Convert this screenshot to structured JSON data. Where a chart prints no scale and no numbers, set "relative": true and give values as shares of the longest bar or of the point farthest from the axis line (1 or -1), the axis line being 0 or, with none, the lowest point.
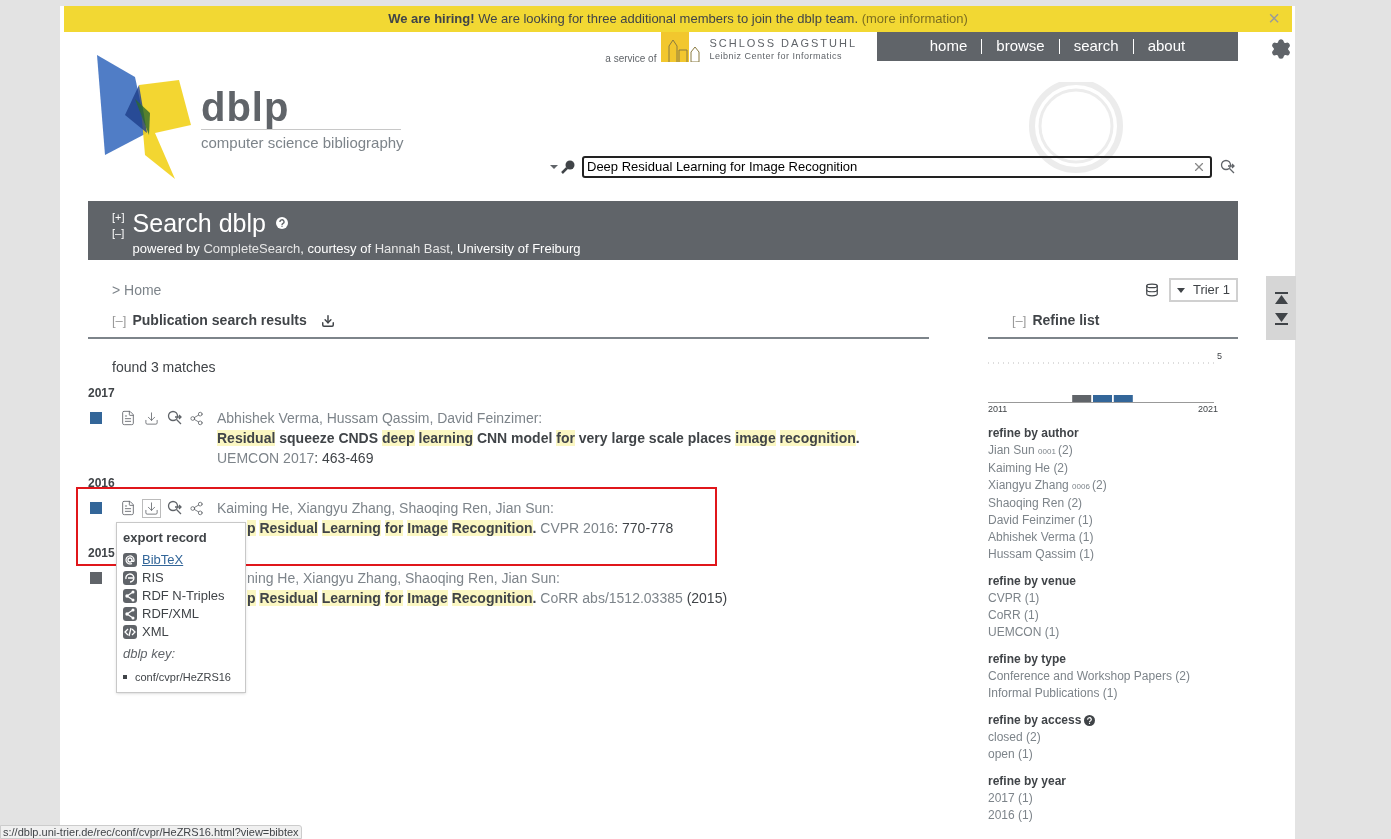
{
  "banner": {
    "text": "**We are hiring!** We are looking for three additional members to join the dblp team.",
    "link": "(more information)",
    "close": "×"
  },
  "header": {
    "logo_title": "dblp",
    "logo_subtitle": "computer science bibliography",
    "service_of": "a service of",
    "dagstuhl_name": "SCHLOSS DAGSTUHL",
    "dagstuhl_sub": "Leibniz Center for Informatics",
    "nav": [
      "home",
      "browse",
      "search",
      "about"
    ],
    "search": {
      "value": "Deep Residual Learning for Image Recognition"
    }
  },
  "search_panel": {
    "expand": "[+]",
    "collapse": "[–]",
    "title": "Search dblp",
    "powered_prefix": "powered by",
    "engine": "CompleteSearch",
    "courtesy": ", courtesy of",
    "person": "Hannah Bast",
    "university": ", University of Freiburg"
  },
  "breadcrumb": "> Home",
  "mirror": "Trier 1",
  "results": {
    "toggle": "[–]",
    "title": "Publication search results",
    "found": "found 3 matches",
    "groups": [
      {
        "year": "2017",
        "entries": [
          {
            "color": "#336699",
            "icons_covered": false,
            "export_open": false,
            "annotated": false,
            "authors_covered": false,
            "title_covered": false,
            "authors": "Abhishek Verma, Hussam Qassim, David Feinzimer:",
            "title": [
              {
                "text": "Residual",
                "hit": true,
                "joined": false
              },
              {
                "text": "squeeze CNDS",
                "hit": false,
                "joined": false
              },
              {
                "text": "deep",
                "hit": true,
                "joined": false
              },
              {
                "text": "learning",
                "hit": true,
                "joined": false
              },
              {
                "text": "CNN model",
                "hit": false,
                "joined": false
              },
              {
                "text": "for",
                "hit": true,
                "joined": false
              },
              {
                "text": "very large scale places",
                "hit": false,
                "joined": false
              },
              {
                "text": "image",
                "hit": true,
                "joined": false
              },
              {
                "text": "recognition",
                "hit": true,
                "joined": false
              },
              {
                "text": ".",
                "hit": false,
                "joined": true
              }
            ],
            "venue": "UEMCON 2017",
            "pages": ": 463-469"
          }
        ]
      },
      {
        "year": "2016",
        "entries": [
          {
            "color": "#336699",
            "icons_covered": false,
            "export_open": true,
            "annotated": true,
            "authors_covered": false,
            "title_covered": true,
            "authors": "Kaiming He, Xiangyu Zhang, Shaoqing Ren, Jian Sun:",
            "title": [
              {
                "text": "p",
                "hit": true,
                "joined": false
              },
              {
                "text": "Residual",
                "hit": true,
                "joined": false
              },
              {
                "text": "Learning",
                "hit": true,
                "joined": false
              },
              {
                "text": "for",
                "hit": true,
                "joined": false
              },
              {
                "text": "Image",
                "hit": true,
                "joined": false
              },
              {
                "text": "Recognition",
                "hit": true,
                "joined": false
              },
              {
                "text": ".",
                "hit": false,
                "joined": true
              }
            ],
            "venue": "CVPR 2016",
            "pages": ": 770-778"
          }
        ]
      },
      {
        "year": "2015",
        "entries": [
          {
            "color": "#606469",
            "icons_covered": true,
            "export_open": false,
            "annotated": false,
            "authors_covered": true,
            "title_covered": true,
            "authors": "ning He, Xiangyu Zhang, Shaoqing Ren, Jian Sun:",
            "title": [
              {
                "text": "p",
                "hit": true,
                "joined": false
              },
              {
                "text": "Residual",
                "hit": true,
                "joined": false
              },
              {
                "text": "Learning",
                "hit": true,
                "joined": false
              },
              {
                "text": "for",
                "hit": true,
                "joined": false
              },
              {
                "text": "Image",
                "hit": true,
                "joined": false
              },
              {
                "text": "Recognition",
                "hit": true,
                "joined": false
              },
              {
                "text": ".",
                "hit": false,
                "joined": true
              }
            ],
            "venue": "CoRR abs/1512.03385",
            "pages": " (2015)"
          }
        ]
      }
    ]
  },
  "export_popup": {
    "title": "export record",
    "items": [
      {
        "kind": "bibtex",
        "label": "BibTeX",
        "selected": true
      },
      {
        "kind": "ris",
        "label": "RIS",
        "selected": false
      },
      {
        "kind": "rdf",
        "label": "RDF N-Triples",
        "selected": false
      },
      {
        "kind": "rdf",
        "label": "RDF/XML",
        "selected": false
      },
      {
        "kind": "xml",
        "label": "XML",
        "selected": false
      }
    ],
    "key_label": "dblp key:",
    "key": "conf/cvpr/HeZRS16"
  },
  "refine": {
    "toggle": "[–]",
    "title": "Refine list",
    "chart_data": {
      "type": "bar",
      "categories": [
        "2011",
        null,
        null,
        null,
        null,
        null,
        null,
        null,
        null,
        null,
        "2021"
      ],
      "relative": true,
      "annotations": [
        {
          "text": "5"
        }
      ],
      "series": [
        {
          "color": "#606469",
          "values": [
            0,
            0,
            0,
            0,
            1,
            0,
            0,
            0,
            0,
            0,
            0
          ]
        },
        {
          "color": "#336699",
          "values": [
            0,
            0,
            0,
            0,
            0,
            1,
            1,
            0,
            0,
            0,
            0
          ]
        }
      ]
    },
    "groups": [
      {
        "title": "refine by author",
        "help": false,
        "items": [
          {
            "label": "Jian Sun",
            "tag": "0001",
            "count": "(2)"
          },
          {
            "label": "Kaiming He",
            "count": "(2)"
          },
          {
            "label": "Xiangyu Zhang",
            "tag": "0006",
            "count": "(2)"
          },
          {
            "label": "Shaoqing Ren",
            "count": "(2)"
          },
          {
            "label": "David Feinzimer",
            "count": "(1)"
          },
          {
            "label": "Abhishek Verma",
            "count": "(1)"
          },
          {
            "label": "Hussam Qassim",
            "count": "(1)"
          }
        ]
      },
      {
        "title": "refine by venue",
        "help": false,
        "items": [
          {
            "label": "CVPR",
            "count": "(1)"
          },
          {
            "label": "CoRR",
            "count": "(1)"
          },
          {
            "label": "UEMCON",
            "count": "(1)"
          }
        ]
      },
      {
        "title": "refine by type",
        "help": false,
        "items": [
          {
            "label": "Conference and Workshop Papers",
            "count": "(2)"
          },
          {
            "label": "Informal Publications",
            "count": "(1)"
          }
        ]
      },
      {
        "title": "refine by access",
        "help": true,
        "items": [
          {
            "label": "closed",
            "count": "(2)"
          },
          {
            "label": "open",
            "count": "(1)"
          }
        ]
      },
      {
        "title": "refine by year",
        "help": false,
        "items": [
          {
            "label": "2017",
            "count": "(1)"
          },
          {
            "label": "2016",
            "count": "(1)"
          }
        ]
      }
    ]
  },
  "status_bar": "s://dblp.uni-trier.de/rec/conf/cvpr/HeZRS16.html?view=bibtex"
}
